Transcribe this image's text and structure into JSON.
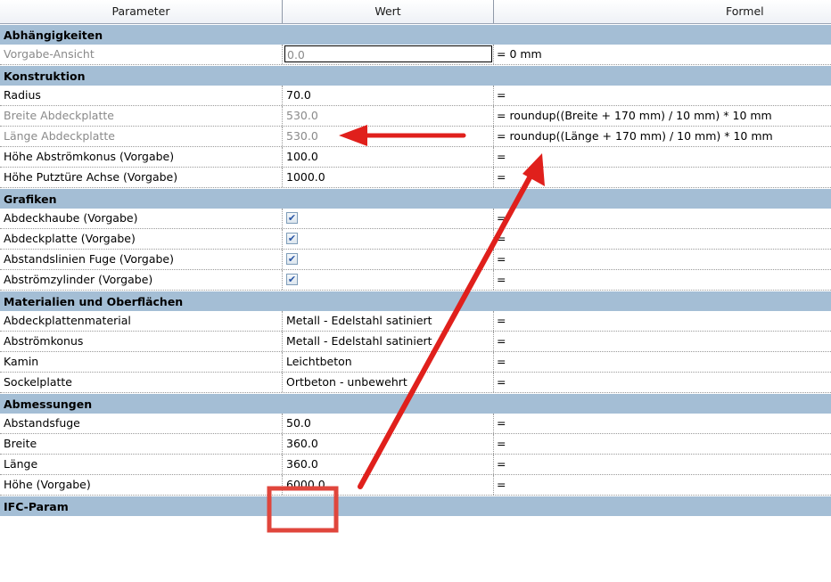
{
  "header": {
    "parameter": "Parameter",
    "wert": "Wert",
    "formel": "Formel"
  },
  "groups": [
    {
      "title": "Abhängigkeiten",
      "rows": [
        {
          "param": "Vorgabe-Ansicht",
          "value": "0.0",
          "formula": "= 0 mm",
          "dim": true,
          "active": true
        }
      ]
    },
    {
      "title": "Konstruktion",
      "rows": [
        {
          "param": "Radius",
          "value": "70.0",
          "formula": "="
        },
        {
          "param": "Breite Abdeckplatte",
          "value": "530.0",
          "formula": "= roundup((Breite + 170 mm) / 10 mm) * 10 mm",
          "dim": true
        },
        {
          "param": "Länge Abdeckplatte",
          "value": "530.0",
          "formula": "= roundup((Länge + 170 mm) / 10 mm) * 10 mm",
          "dim": true
        },
        {
          "param": "Höhe Abströmkonus (Vorgabe)",
          "value": "100.0",
          "formula": "="
        },
        {
          "param": "Höhe Putztüre Achse (Vorgabe)",
          "value": "1000.0",
          "formula": "="
        }
      ]
    },
    {
      "title": "Grafiken",
      "rows": [
        {
          "param": "Abdeckhaube (Vorgabe)",
          "check": true,
          "formula": "="
        },
        {
          "param": "Abdeckplatte (Vorgabe)",
          "check": true,
          "formula": "="
        },
        {
          "param": "Abstandslinien Fuge (Vorgabe)",
          "check": true,
          "formula": "="
        },
        {
          "param": "Abströmzylinder (Vorgabe)",
          "check": true,
          "formula": "="
        }
      ]
    },
    {
      "title": "Materialien und Oberflächen",
      "rows": [
        {
          "param": "Abdeckplattenmaterial",
          "value": "Metall - Edelstahl satiniert",
          "formula": "="
        },
        {
          "param": "Abströmkonus",
          "value": "Metall - Edelstahl satiniert",
          "formula": "="
        },
        {
          "param": "Kamin",
          "value": "Leichtbeton",
          "formula": "="
        },
        {
          "param": "Sockelplatte",
          "value": "Ortbeton - unbewehrt",
          "formula": "="
        }
      ]
    },
    {
      "title": "Abmessungen",
      "rows": [
        {
          "param": "Abstandsfuge",
          "value": "50.0",
          "formula": "="
        },
        {
          "param": "Breite",
          "value": "360.0",
          "formula": "="
        },
        {
          "param": "Länge",
          "value": "360.0",
          "formula": "="
        },
        {
          "param": "Höhe (Vorgabe)",
          "value": "6000.0",
          "formula": "="
        }
      ]
    },
    {
      "title": "IFC-Param",
      "rows": []
    }
  ],
  "colors": {
    "group_bg": "#a4bed5",
    "arrow": "#e0201c",
    "highlight_box": "#e0463c",
    "dim_text": "#8a8a8a"
  },
  "checkmark_glyph": "✔"
}
